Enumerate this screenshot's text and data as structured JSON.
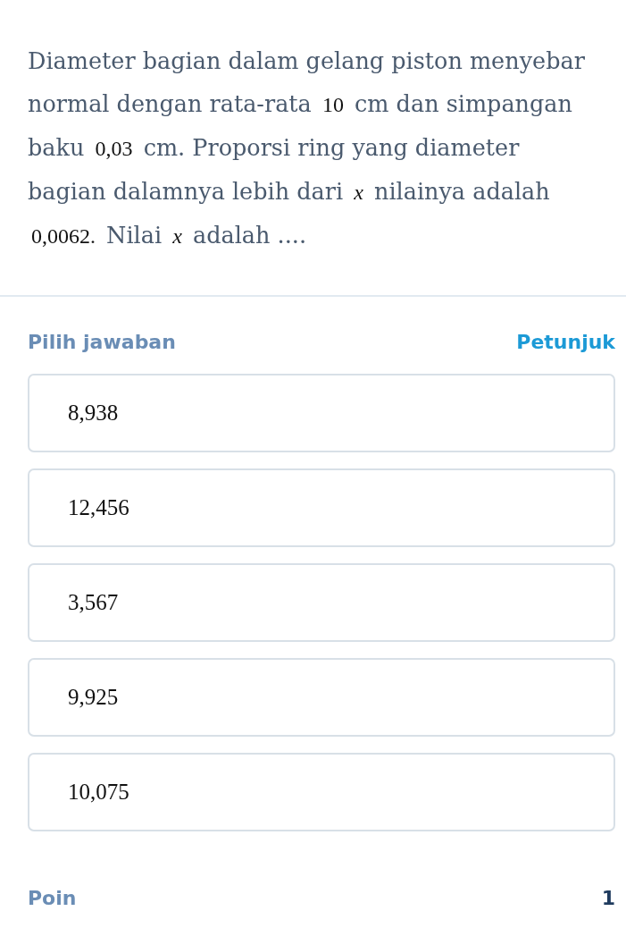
{
  "question": {
    "segments": [
      {
        "kind": "text",
        "text": "Diameter bagian dalam gelang piston menyebar normal dengan rata-rata"
      },
      {
        "kind": "number",
        "text": "10"
      },
      {
        "kind": "text",
        "text": "cm dan simpangan baku"
      },
      {
        "kind": "number",
        "text": "0,03"
      },
      {
        "kind": "text",
        "text": "cm. Proporsi ring yang diameter bagian dalamnya lebih dari"
      },
      {
        "kind": "variable",
        "text": "x"
      },
      {
        "kind": "text",
        "text": "nilainya adalah"
      },
      {
        "kind": "number",
        "text": "0,0062."
      },
      {
        "kind": "text",
        "text": "Nilai"
      },
      {
        "kind": "variable",
        "text": "x"
      },
      {
        "kind": "text",
        "text": "adalah ...."
      }
    ]
  },
  "answer_header": {
    "label": "Pilih jawaban",
    "hint_link": "Petunjuk"
  },
  "options": [
    {
      "text": "8,938",
      "selected": false
    },
    {
      "text": "12,456",
      "selected": false
    },
    {
      "text": "3,567",
      "selected": false
    },
    {
      "text": "9,925",
      "selected": false
    },
    {
      "text": "10,075",
      "selected": false
    }
  ],
  "points": {
    "label": "Poin",
    "value": "1"
  }
}
